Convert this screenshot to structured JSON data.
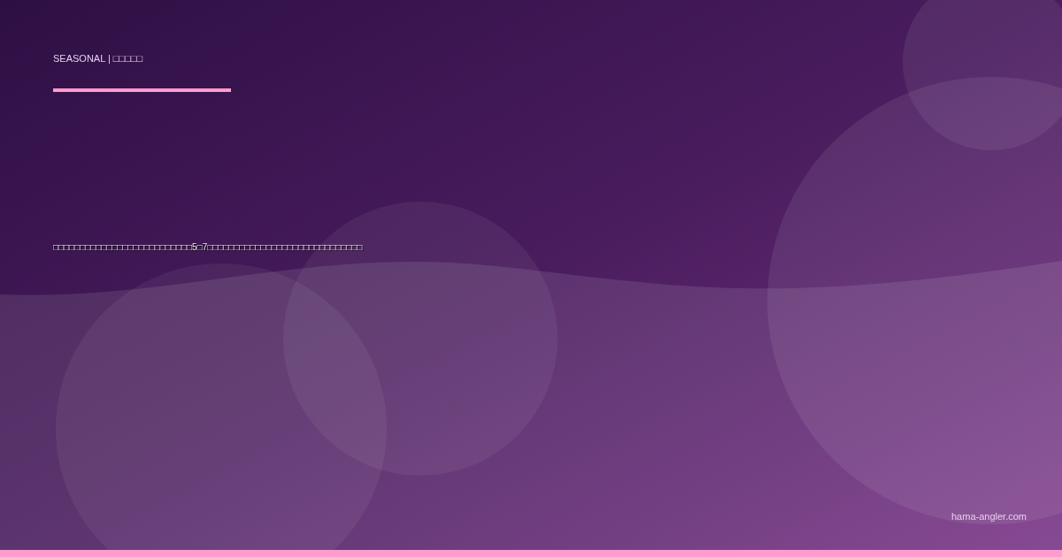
{
  "category": "SEASONAL | □□□□□",
  "title": "□□□□□□□□□□□□□□□□□□□□□□□□□□5□7□□□□□□□□□□□□□□□□□□□□□□□□□□□□□",
  "domain": "hama-angler.com"
}
